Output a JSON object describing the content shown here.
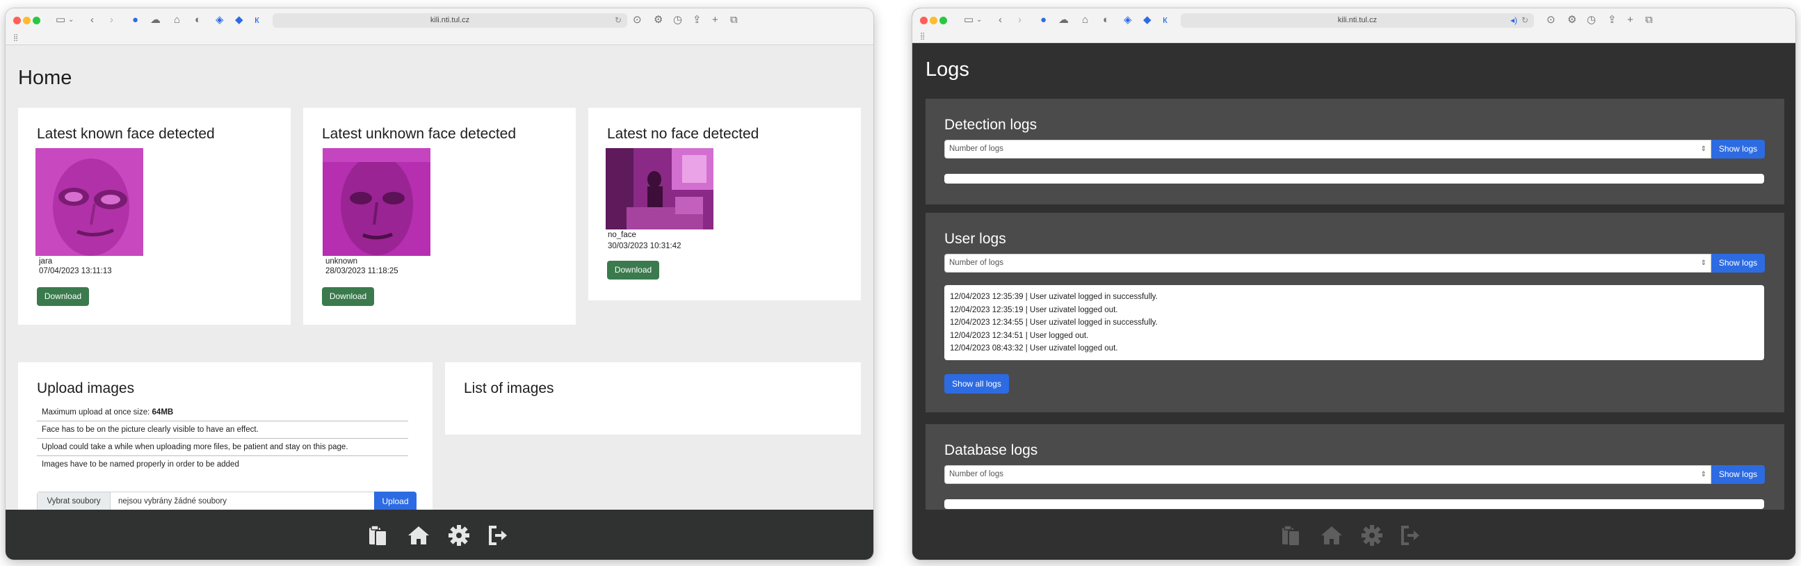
{
  "browser": {
    "url": "kili.nti.tul.cz",
    "sidebar_icon": "sidebar-icon",
    "back_icon": "chevron-left-icon",
    "forward_icon": "chevron-right-icon"
  },
  "home": {
    "title": "Home",
    "cards": [
      {
        "title": "Latest known face detected",
        "name": "jara",
        "timestamp": "07/04/2023 13:11:13",
        "button": "Download"
      },
      {
        "title": "Latest unknown face detected",
        "name": "unknown",
        "timestamp": "28/03/2023 11:18:25",
        "button": "Download"
      },
      {
        "title": "Latest no face detected",
        "name": "no_face",
        "timestamp": "30/03/2023 10:31:42",
        "button": "Download"
      }
    ],
    "upload": {
      "title": "Upload images",
      "max_label": "Maximum upload at once size: ",
      "max_value": "64MB",
      "notes": [
        "Face has to be on the picture clearly visible to have an effect.",
        "Upload could take a while when uploading more files, be patient and stay on this page.",
        "Images have to be named properly in order to be added"
      ],
      "choose_label": "Vybrat soubory",
      "no_file_text": "nejsou vybrány žádné soubory",
      "upload_button": "Upload"
    },
    "list": {
      "title": "List of images"
    }
  },
  "logs": {
    "title": "Logs",
    "detection": {
      "title": "Detection logs",
      "placeholder": "Number of logs",
      "button": "Show logs"
    },
    "user": {
      "title": "User logs",
      "placeholder": "Number of logs",
      "button": "Show logs",
      "entries": [
        "12/04/2023 12:35:39 | User uzivatel logged in successfully.",
        "12/04/2023 12:35:19 | User uzivatel logged out.",
        "12/04/2023 12:34:55 | User uzivatel logged in successfully.",
        "12/04/2023 12:34:51 | User logged out.",
        "12/04/2023 08:43:32 | User uzivatel logged out."
      ],
      "show_all": "Show all logs"
    },
    "database": {
      "title": "Database logs",
      "placeholder": "Number of logs",
      "button": "Show logs"
    }
  },
  "footer_icons": [
    "clipboard-icon",
    "home-icon",
    "gear-icon",
    "logout-icon"
  ],
  "colors": {
    "accent_blue": "#2d6be2",
    "download_green": "#3a7a4d",
    "footer_dark": "#303231",
    "logs_bg": "#2f302f",
    "log_card": "#4b4b4b",
    "thumb_magenta": "#c02fc0"
  }
}
